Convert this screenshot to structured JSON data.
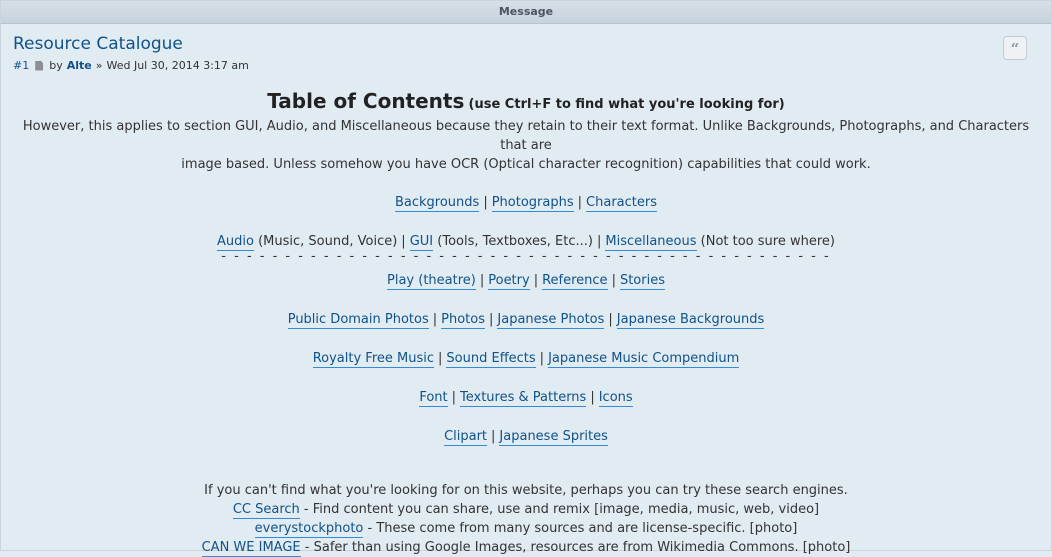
{
  "header": {
    "title": "Message"
  },
  "post": {
    "title": "Resource Catalogue",
    "number": "#1",
    "by": "by",
    "author": "Alte",
    "sep": "»",
    "date": "Wed Jul 30, 2014 3:17 am",
    "quote_icon": "quote-icon"
  },
  "toc": {
    "title": "Table of Contents",
    "hint": "(use Ctrl+F to find what you're looking for)",
    "note_1": "However, this applies to section GUI, Audio, and Miscellaneous because they retain to their text format. Unlike Backgrounds, Photographs, and Characters that are",
    "note_2": "image based. Unless somehow you have OCR (Optical character recognition) capabilities that could work.",
    "row1": [
      "Backgrounds",
      "Photographs",
      "Characters"
    ],
    "row2": {
      "audio": "Audio",
      "audio_note": "(Music, Sound, Voice)",
      "gui": "GUI",
      "gui_note": "(Tools, Textboxes, Etc...)",
      "misc": "Miscellaneous",
      "misc_note": "(Not too sure where)"
    },
    "dashes": "- - - - - - - - - - - - - - - - - - - - - - - - - - - - - - - - - - - - - - - - - - - - - - - -",
    "row3": [
      "Play (theatre)",
      "Poetry",
      "Reference",
      "Stories"
    ],
    "row4": [
      "Public Domain Photos",
      "Photos",
      "Japanese Photos",
      "Japanese Backgrounds"
    ],
    "row5": [
      "Royalty Free Music",
      "Sound Effects",
      "Japanese Music Compendium"
    ],
    "row6": [
      "Font",
      "Textures & Patterns",
      "Icons"
    ],
    "row7": [
      "Clipart",
      "Japanese Sprites"
    ],
    "pipe": "|"
  },
  "search": {
    "intro": "If you can't find what you're looking for on this website, perhaps you can try these search engines.",
    "items": [
      {
        "link": "CC Search",
        "desc": " - Find content you can share, use and remix [image, media, music, web, video]"
      },
      {
        "link": "everystockphoto",
        "desc": " - These come from many sources and are license-specific. [photo]"
      },
      {
        "link": "CAN WE IMAGE",
        "desc": " - Safer than using Google Images, resources are from Wikimedia Commons. [photo]"
      }
    ]
  }
}
